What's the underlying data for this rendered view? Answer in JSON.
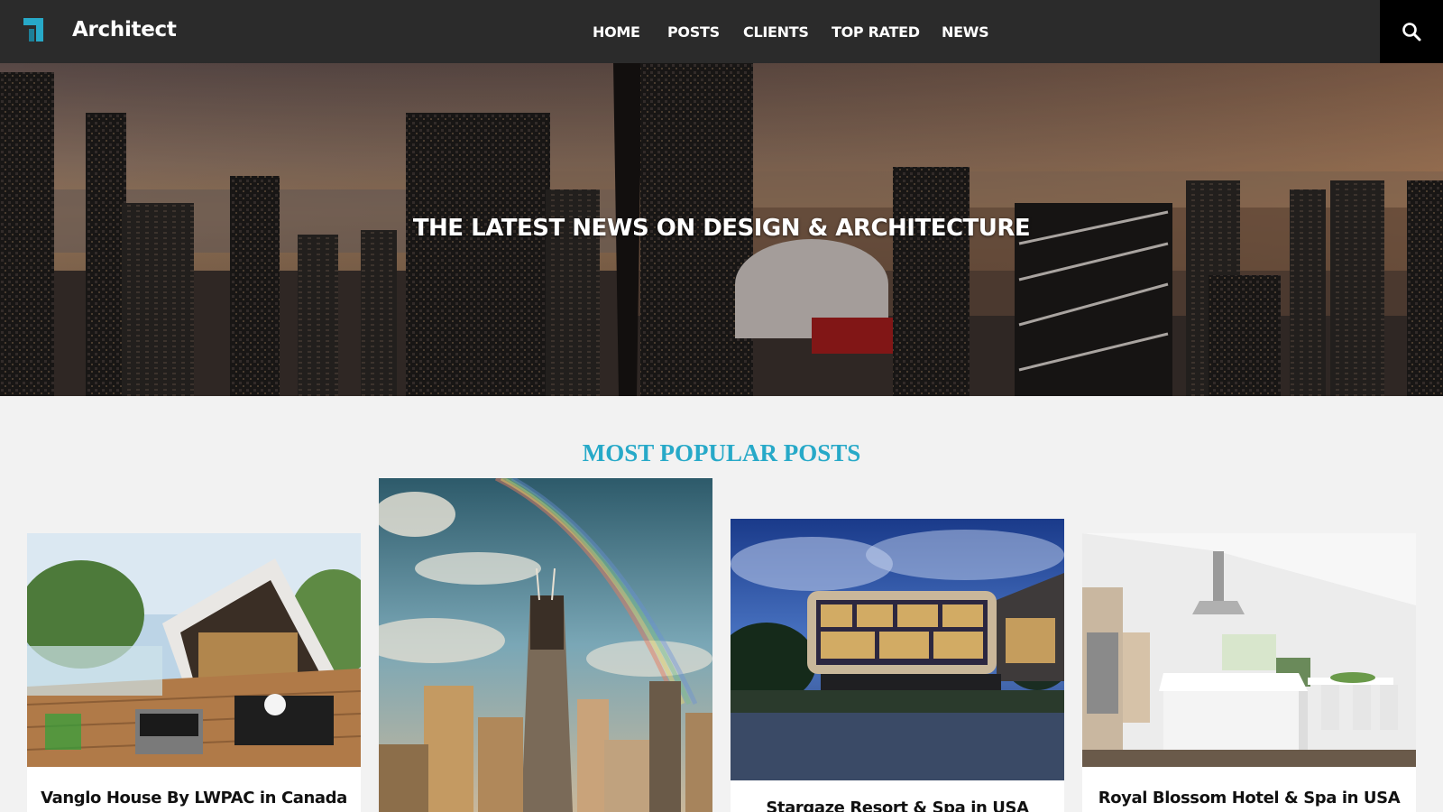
{
  "header": {
    "brand": "Architect",
    "nav": [
      "HOME",
      "POSTS",
      "CLIENTS",
      "TOP RATED",
      "NEWS"
    ]
  },
  "hero": {
    "title": "THE LATEST NEWS ON DESIGN & ARCHITECTURE"
  },
  "popular": {
    "title": "MOST POPULAR POSTS",
    "posts": [
      {
        "title": "Vanglo House By LWPAC in Canada"
      },
      {
        "title": ""
      },
      {
        "title": "Stargaze Resort & Spa in USA"
      },
      {
        "title": "Royal Blossom Hotel & Spa in USA"
      }
    ]
  },
  "colors": {
    "accent": "#27a9c8",
    "topbar": "#2b2b2b"
  }
}
